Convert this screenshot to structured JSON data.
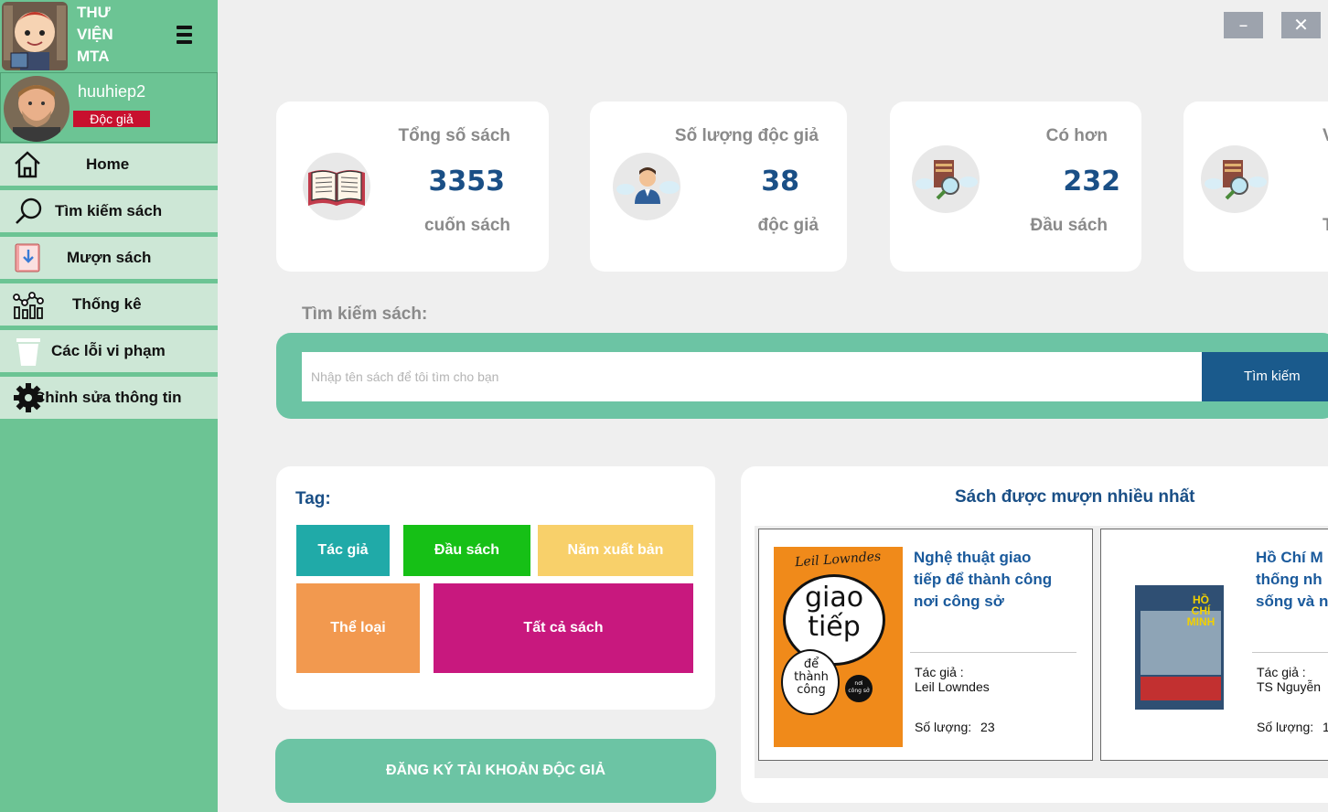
{
  "brand": {
    "title_line1": "THƯ",
    "title_line2": "VIỆN",
    "title_line3": "MTA"
  },
  "user": {
    "name": "huuhiep2",
    "role": "Độc giả"
  },
  "nav": [
    {
      "label": "Home",
      "icon": "home-icon"
    },
    {
      "label": "Tìm kiếm sách",
      "icon": "search-icon"
    },
    {
      "label": "Mượn sách",
      "icon": "borrow-book-icon"
    },
    {
      "label": "Thống kê",
      "icon": "statistics-icon"
    },
    {
      "label": "Các lỗi vi phạm",
      "icon": "trash-icon"
    },
    {
      "label": "Chỉnh sửa thông tin",
      "icon": "gear-icon"
    }
  ],
  "window": {
    "minimize": "–",
    "close": "✕"
  },
  "stats": [
    {
      "label": "Tổng số sách",
      "value": "3353",
      "unit": "cuốn sách",
      "icon": "open-book-icon"
    },
    {
      "label": "Số lượng độc giả",
      "value": "38",
      "unit": "độc giả",
      "icon": "reader-icon"
    },
    {
      "label": "Có hơn",
      "value": "232",
      "unit": "Đầu sách",
      "icon": "book-search-icon"
    },
    {
      "label": "V",
      "value": "",
      "unit": "T",
      "icon": "book-search-icon"
    }
  ],
  "search": {
    "title": "Tìm kiếm sách:",
    "placeholder": "Nhập tên sách để tôi tìm cho bạn",
    "value": "",
    "button": "Tìm kiếm"
  },
  "tags": {
    "title": "Tag:",
    "items": [
      {
        "label": "Tác giả",
        "color": "#20aaa8"
      },
      {
        "label": "Đầu sách",
        "color": "#16c016"
      },
      {
        "label": "Năm xuất bản",
        "color": "#f8d06a"
      },
      {
        "label": "Thể loại",
        "color": "#f2994f"
      },
      {
        "label": "Tất cả sách",
        "color": "#c8187e"
      }
    ]
  },
  "register": {
    "label": "ĐĂNG KÝ TÀI KHOẢN ĐỘC GIẢ"
  },
  "top_borrowed": {
    "title": "Sách được mượn nhiều nhất",
    "books": [
      {
        "title_lines": [
          "Nghệ thuật giao",
          "tiếp để thành công",
          "nơi công sở"
        ],
        "author_label": "Tác giả :",
        "author": "Leil Lowndes",
        "quantity_label": "Số lượng:",
        "quantity": "23",
        "cover_text": [
          "Leil Lowndes",
          "giao",
          "tiếp",
          "để",
          "thành",
          "công",
          "nơi",
          "công sở"
        ]
      },
      {
        "title_lines": [
          "Hồ Chí M",
          "thống nh",
          "sống và n"
        ],
        "author_label": "Tác giả :",
        "author": "TS Nguyễn",
        "quantity_label": "Số lượng:",
        "quantity": "1",
        "cover_text": [
          "HỒ",
          "CHÍ",
          "MINH"
        ]
      }
    ]
  },
  "colors": {
    "sidebar": "#6cc494",
    "nav_item": "#cde7d6",
    "accent": "#1a4f86",
    "search_band": "#6cc4a4"
  }
}
